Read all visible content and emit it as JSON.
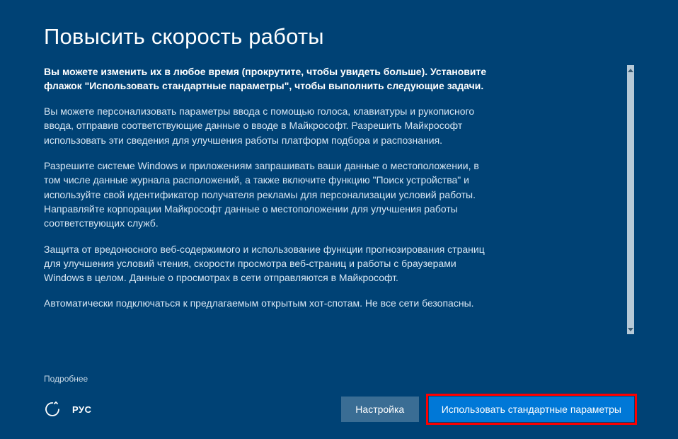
{
  "title": "Повысить скорость работы",
  "intro": "Вы можете изменить их в любое время (прокрутите, чтобы увидеть больше). Установите флажок \"Использовать стандартные параметры\", чтобы выполнить следующие задачи.",
  "paragraphs": [
    "Вы можете персонализовать параметры ввода с помощью голоса, клавиатуры и рукописного ввода, отправив соответствующие данные о вводе в Майкрософт. Разрешить Майкрософт использовать эти сведения для улучшения работы платформ подбора и распознания.",
    "Разрешите системе Windows и приложениям запрашивать ваши данные о местоположении, в том числе данные журнала расположений, а также включите функцию \"Поиск устройства\" и используйте свой идентификатор получателя рекламы для персонализации условий работы. Направляйте корпорации Майкрософт данные о местоположении для улучшения работы соответствующих служб.",
    "Защита от вредоносного веб-содержимого и использование функции прогнозирования страниц для улучшения условий чтения, скорости просмотра веб-страниц и работы с браузерами Windows в целом. Данные о просмотрах в сети отправляются в Майкрософт.",
    "Автоматически подключаться к предлагаемым открытым хот-спотам. Не все сети безопасны."
  ],
  "more_link": "Подробнее",
  "language_label": "РУС",
  "buttons": {
    "customize": "Настройка",
    "express": "Использовать стандартные параметры"
  }
}
